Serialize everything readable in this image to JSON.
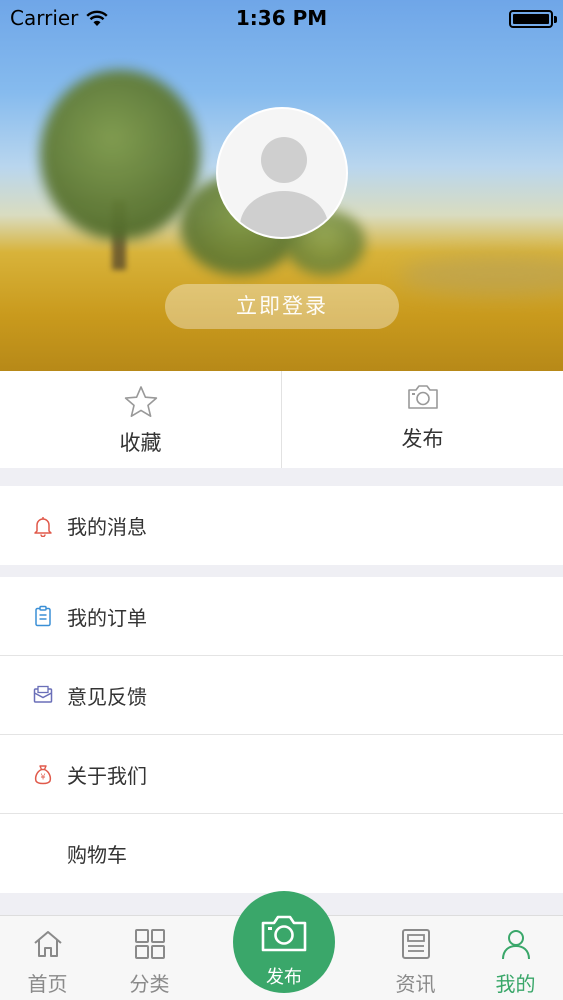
{
  "status_bar": {
    "carrier": "Carrier",
    "time": "1:36 PM"
  },
  "header": {
    "login_button": "立即登录"
  },
  "actions": [
    {
      "label": "收藏",
      "icon": "star-icon"
    },
    {
      "label": "发布",
      "icon": "camera-icon"
    }
  ],
  "menu": {
    "messages": {
      "label": "我的消息",
      "icon": "bell-icon",
      "color": "#e0594a"
    },
    "orders": {
      "label": "我的订单",
      "icon": "clipboard-icon",
      "color": "#3a8fd6"
    },
    "feedback": {
      "label": "意见反馈",
      "icon": "envelope-icon",
      "color": "#6a6fb8"
    },
    "about": {
      "label": "关于我们",
      "icon": "money-bag-icon",
      "color": "#e0594a"
    },
    "cart": {
      "label": "购物车"
    }
  },
  "tabbar": {
    "home": "首页",
    "category": "分类",
    "publish": "发布",
    "news": "资讯",
    "mine": "我的",
    "active_color": "#3aa76a",
    "inactive_color": "#8a8a8a"
  }
}
